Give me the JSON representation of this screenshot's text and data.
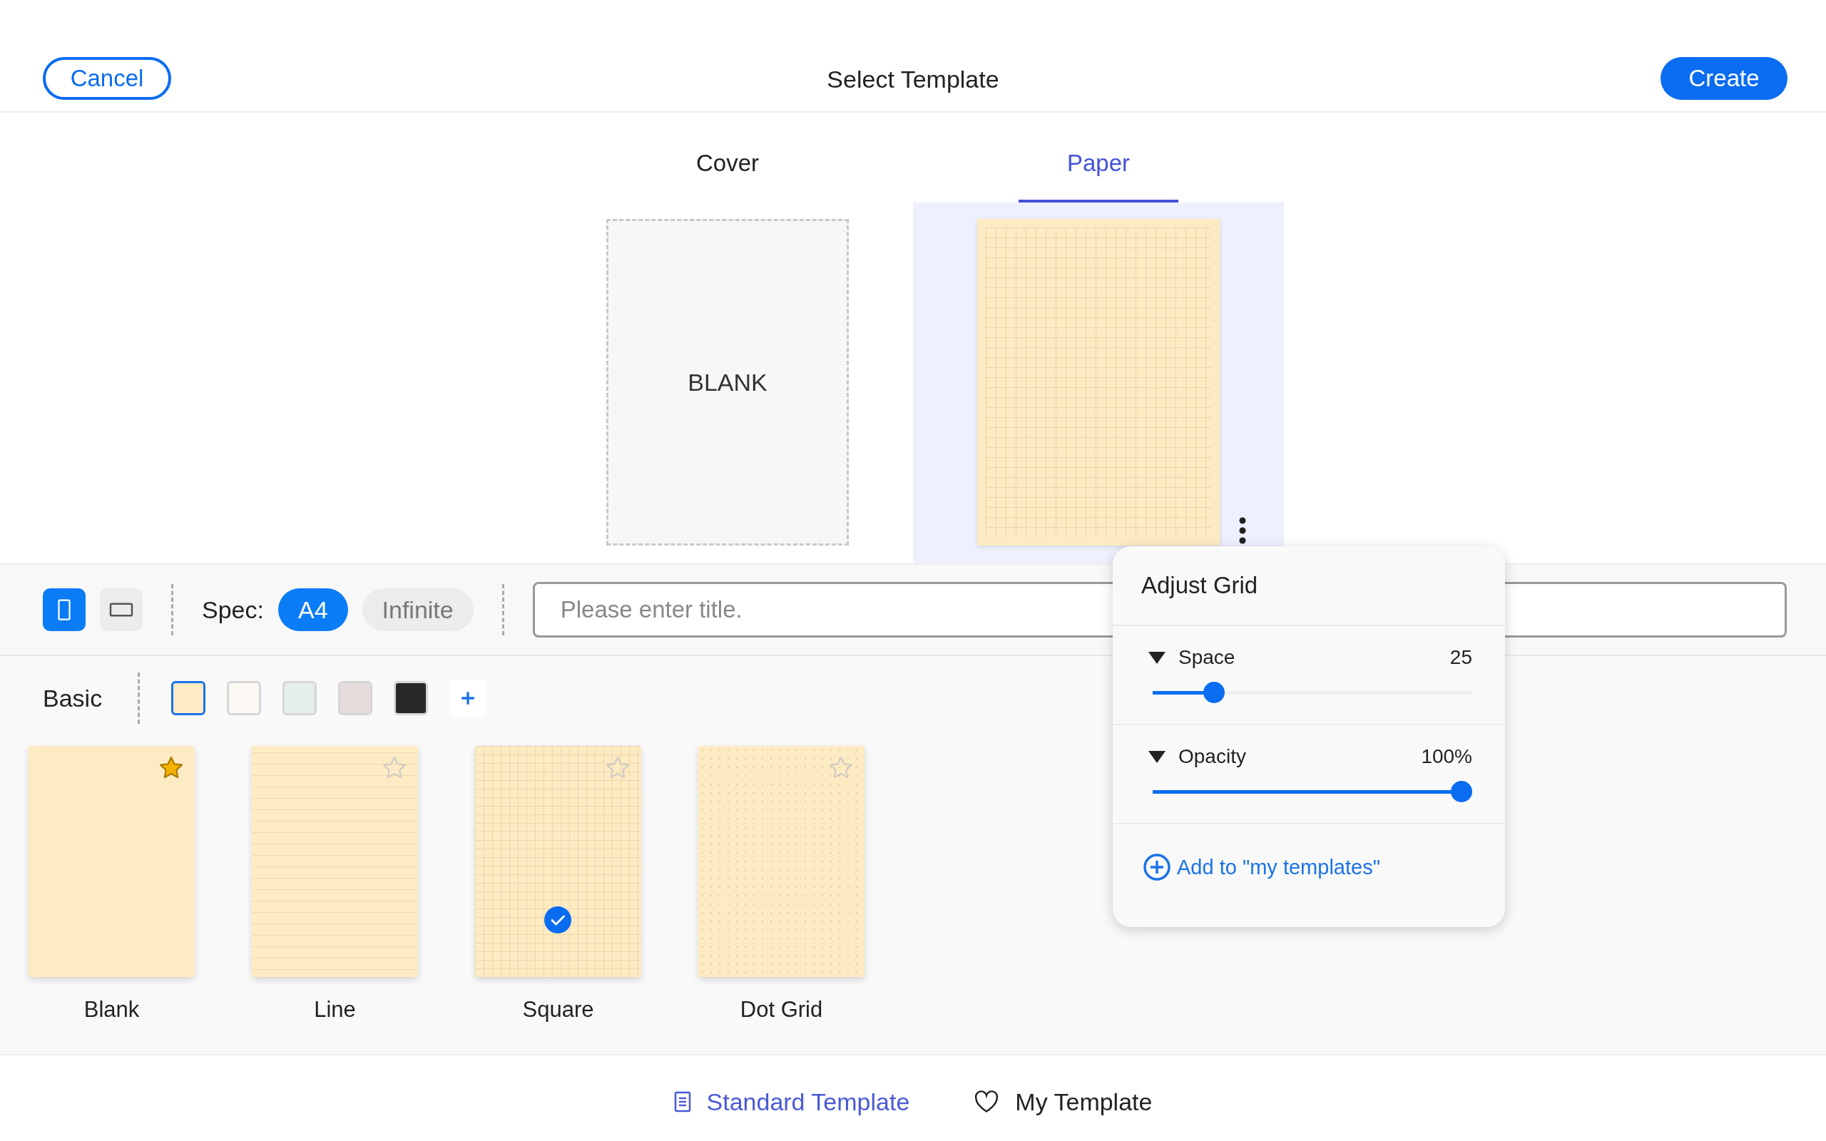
{
  "header": {
    "cancel": "Cancel",
    "title": "Select Template",
    "create": "Create"
  },
  "tabs": [
    {
      "label": "Cover",
      "selected": false,
      "preview": {
        "kind": "blank",
        "text": "BLANK"
      }
    },
    {
      "label": "Paper",
      "selected": true,
      "preview": {
        "kind": "grid"
      }
    }
  ],
  "toolbar": {
    "orientations": [
      {
        "kind": "portrait",
        "selected": true
      },
      {
        "kind": "landscape",
        "selected": false
      }
    ],
    "spec_label": "Spec:",
    "specs": [
      {
        "label": "A4",
        "selected": true
      },
      {
        "label": "Infinite",
        "selected": false
      }
    ],
    "title_field": {
      "placeholder": "Please enter title."
    }
  },
  "colors": {
    "label": "Basic",
    "swatches": [
      {
        "color": "#fdebc3",
        "selected": true
      },
      {
        "color": "#fbf7f2",
        "selected": false
      },
      {
        "color": "#e6eeed",
        "selected": false
      },
      {
        "color": "#e6dcdc",
        "selected": false
      },
      {
        "color": "#282828",
        "selected": false
      }
    ]
  },
  "templates": [
    {
      "label": "Blank",
      "kind": "blank",
      "favorite": true,
      "selected": false
    },
    {
      "label": "Line",
      "kind": "line",
      "favorite": false,
      "selected": false
    },
    {
      "label": "Square",
      "kind": "square",
      "favorite": false,
      "selected": true
    },
    {
      "label": "Dot Grid",
      "kind": "dot",
      "favorite": false,
      "selected": false
    }
  ],
  "popup": {
    "title": "Adjust Grid",
    "settings": [
      {
        "label": "Space",
        "value": "25",
        "level": 0.17
      },
      {
        "label": "Opacity",
        "value": "100%",
        "level": 1
      }
    ],
    "add_link": "Add to \"my templates\""
  },
  "bottom_tabs": [
    {
      "label": "Standard Template",
      "kind": "standard",
      "selected": true
    },
    {
      "label": "My Template",
      "kind": "mine",
      "selected": false
    }
  ]
}
